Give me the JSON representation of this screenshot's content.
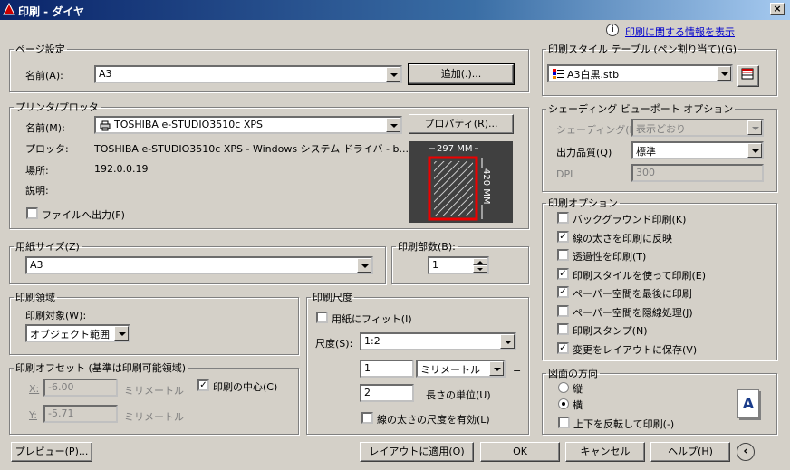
{
  "window": {
    "title": "印刷 - ダイヤ",
    "close": "×"
  },
  "info_link": "印刷に関する情報を表示",
  "page_setup": {
    "legend": "ページ設定",
    "name_label": "名前(A):",
    "name_value": "A3",
    "add_button": "追加(.)..."
  },
  "printer": {
    "legend": "プリンタ/プロッタ",
    "name_label": "名前(M):",
    "name_value": "TOSHIBA e-STUDIO3510c XPS",
    "properties_button": "プロパティ(R)...",
    "plotter_label": "プロッタ:",
    "plotter_value": "TOSHIBA e-STUDIO3510c XPS - Windows システム ドライバ - b...",
    "location_label": "場所:",
    "location_value": "192.0.0.19",
    "description_label": "説明:",
    "print_to_file": "ファイルへ出力(F)",
    "preview_width": "297 MM",
    "preview_height": "420 MM"
  },
  "paper_size": {
    "legend": "用紙サイズ(Z)",
    "value": "A3"
  },
  "copies": {
    "legend": "印刷部数(B):",
    "value": "1"
  },
  "plot_area": {
    "legend": "印刷領域",
    "what_label": "印刷対象(W):",
    "what_value": "オブジェクト範囲"
  },
  "plot_offset": {
    "legend": "印刷オフセット (基準は印刷可能領域)",
    "x_label": "X:",
    "x_value": "-6.00",
    "y_label": "Y:",
    "y_value": "-5.71",
    "unit": "ミリメートル",
    "center": "印刷の中心(C)"
  },
  "plot_scale": {
    "legend": "印刷尺度",
    "fit": "用紙にフィット(I)",
    "scale_label": "尺度(S):",
    "scale_value": "1:2",
    "value1": "1",
    "unit_value": "ミリメートル",
    "equals": "=",
    "value2": "2",
    "unit_length": "長さの単位(U)",
    "scale_lineweights": "線の太さの尺度を有効(L)"
  },
  "plot_style": {
    "legend": "印刷スタイル テーブル (ペン割り当て)(G)",
    "value": "A3白黒.stb"
  },
  "shaded": {
    "legend": "シェーディング ビューポート オプション",
    "shade_label": "シェーディング(D)",
    "shade_value": "表示どおり",
    "quality_label": "出力品質(Q)",
    "quality_value": "標準",
    "dpi_label": "DPI",
    "dpi_value": "300"
  },
  "options": {
    "legend": "印刷オプション",
    "items": [
      {
        "label": "バックグラウンド印刷(K)",
        "checked": false
      },
      {
        "label": "線の太さを印刷に反映",
        "checked": true
      },
      {
        "label": "透過性を印刷(T)",
        "checked": false
      },
      {
        "label": "印刷スタイルを使って印刷(E)",
        "checked": true
      },
      {
        "label": "ペーパー空間を最後に印刷",
        "checked": true
      },
      {
        "label": "ペーパー空間を隠線処理(J)",
        "checked": false
      },
      {
        "label": "印刷スタンプ(N)",
        "checked": false
      },
      {
        "label": "変更をレイアウトに保存(V)",
        "checked": true
      }
    ]
  },
  "orientation": {
    "legend": "図面の方向",
    "portrait": "縦",
    "landscape": "横",
    "upside_down": "上下を反転して印刷(-)",
    "selected": "landscape"
  },
  "bottom": {
    "preview": "プレビュー(P)...",
    "apply": "レイアウトに適用(O)",
    "ok": "OK",
    "cancel": "キャンセル",
    "help": "ヘルプ(H)"
  }
}
